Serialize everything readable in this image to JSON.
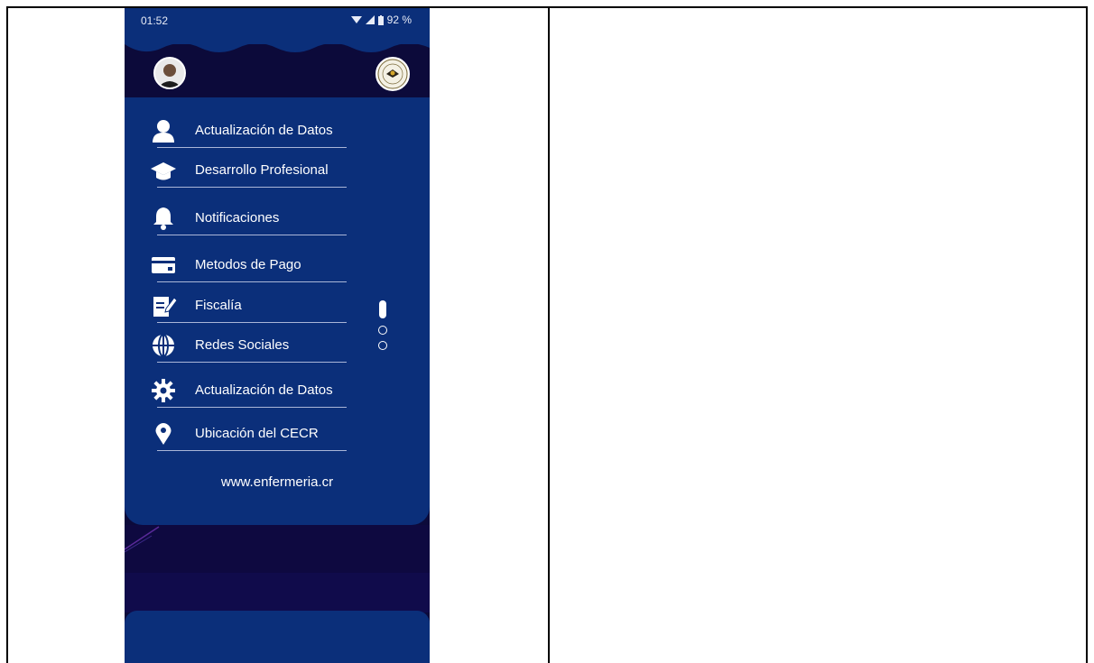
{
  "status_bar": {
    "time": "01:52",
    "battery": "92 %"
  },
  "menu": {
    "items": [
      {
        "label": "Actualización de Datos",
        "icon": "user-icon"
      },
      {
        "label": "Desarrollo Profesional",
        "icon": "graduation-cap-icon"
      },
      {
        "label": "Notificaciones",
        "icon": "bell-icon"
      },
      {
        "label": "Metodos de Pago",
        "icon": "credit-card-icon"
      },
      {
        "label": "Fiscalía",
        "icon": "edit-document-icon"
      },
      {
        "label": "Redes Sociales",
        "icon": "globe-icon"
      },
      {
        "label": "Actualización de Datos",
        "icon": "gear-icon"
      },
      {
        "label": "Ubicación del CECR",
        "icon": "map-pin-icon"
      }
    ]
  },
  "website": "www.enfermeria.cr",
  "pager": {
    "total": 3,
    "active": 1
  },
  "colors": {
    "panel": "#0b2f7a",
    "background": "#0c0a3a",
    "text": "#ffffff"
  }
}
